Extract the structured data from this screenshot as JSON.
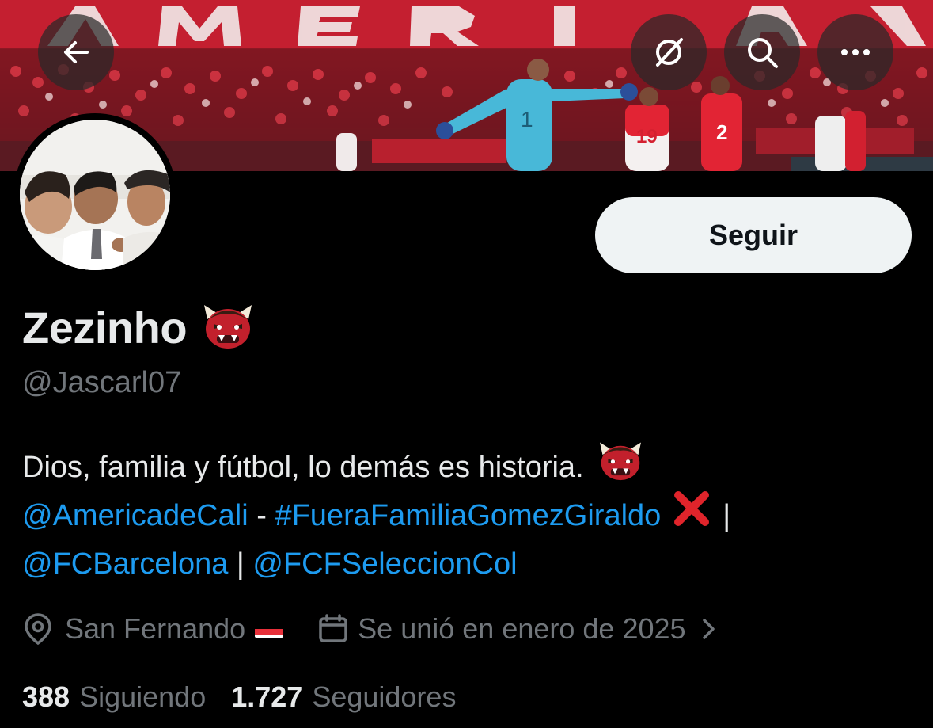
{
  "banner": {
    "alt_icons": [
      "back-arrow-icon",
      "translate-off-icon",
      "search-icon",
      "more-icon"
    ]
  },
  "profile": {
    "display_name": "Zezinho",
    "name_emoji": "👹",
    "handle": "@Jascarl07",
    "follow_label": "Seguir"
  },
  "bio": {
    "line1_text": "Dios, familia y fútbol, lo demás es historia.",
    "line2_mention_1": "@AmericadeCali",
    "line2_dash": " - ",
    "line2_hashtag": "#FueraFamiliaGomezGiraldo",
    "line2_pipe": "|",
    "line3_mention_1": "@FCBarcelona",
    "line3_pipe": " | ",
    "line3_mention_2": "@FCFSeleccionCol"
  },
  "meta": {
    "location": "San Fernando",
    "joined": "Se unió en enero de 2025"
  },
  "stats": {
    "following_count": "388",
    "following_label": "Siguiendo",
    "followers_count": "1.727",
    "followers_label": "Seguidores"
  },
  "colors": {
    "background": "#000000",
    "link": "#1d9bf0",
    "muted": "#71767b",
    "text": "#e7e9ea",
    "follow_button": "#eff3f4",
    "x_mark": "#e0242b"
  }
}
